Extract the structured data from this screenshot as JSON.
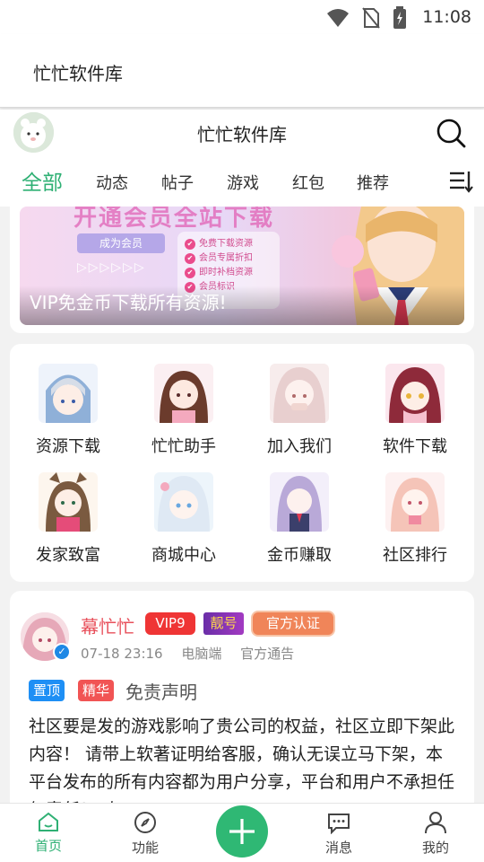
{
  "status_bar": {
    "time": "11:08"
  },
  "app_title": "忙忙软件库",
  "header": {
    "title": "忙忙软件库"
  },
  "tabs": [
    {
      "label": "全部",
      "active": true
    },
    {
      "label": "动态"
    },
    {
      "label": "帖子"
    },
    {
      "label": "游戏"
    },
    {
      "label": "红包"
    },
    {
      "label": "推荐"
    }
  ],
  "banner": {
    "headline": "开通会员全站下载",
    "vip_tag": "成为会员",
    "arrows": "▷▷▷▷▷▷",
    "benefits": [
      "免费下载资源",
      "会员专属折扣",
      "即时补档资源",
      "会员标识"
    ],
    "caption": "VIP免金币下载所有资源!"
  },
  "grid": [
    {
      "label": "资源下载"
    },
    {
      "label": "忙忙助手"
    },
    {
      "label": "加入我们"
    },
    {
      "label": "软件下载"
    },
    {
      "label": "发家致富"
    },
    {
      "label": "商城中心"
    },
    {
      "label": "金币赚取"
    },
    {
      "label": "社区排行"
    }
  ],
  "post": {
    "username": "幕忙忙",
    "badge_vip": "VIP9",
    "badge_pretty": "靓号",
    "badge_official": "官方认证",
    "date": "07-18 23:16",
    "device": "电脑端",
    "category": "官方通告",
    "tag_top": "置顶",
    "tag_featured": "精华",
    "title": "免责声明",
    "body": "社区要是发的游戏影响了贵公司的权益，社区立即下架此内容！ 请带上软著证明给客服，确认无误立马下架，本平台发布的所有内容都为用户分享，平台和用户不承担任何责任！ 欢"
  },
  "bottom_nav": [
    {
      "label": "首页",
      "active": true
    },
    {
      "label": "功能"
    },
    {
      "label": "消息"
    },
    {
      "label": "我的"
    }
  ],
  "colors": {
    "accent": "#2fb074",
    "vip": "#ef3535",
    "official": "#f08559",
    "top_tag": "#1e8ff5",
    "featured_tag": "#f15454"
  }
}
